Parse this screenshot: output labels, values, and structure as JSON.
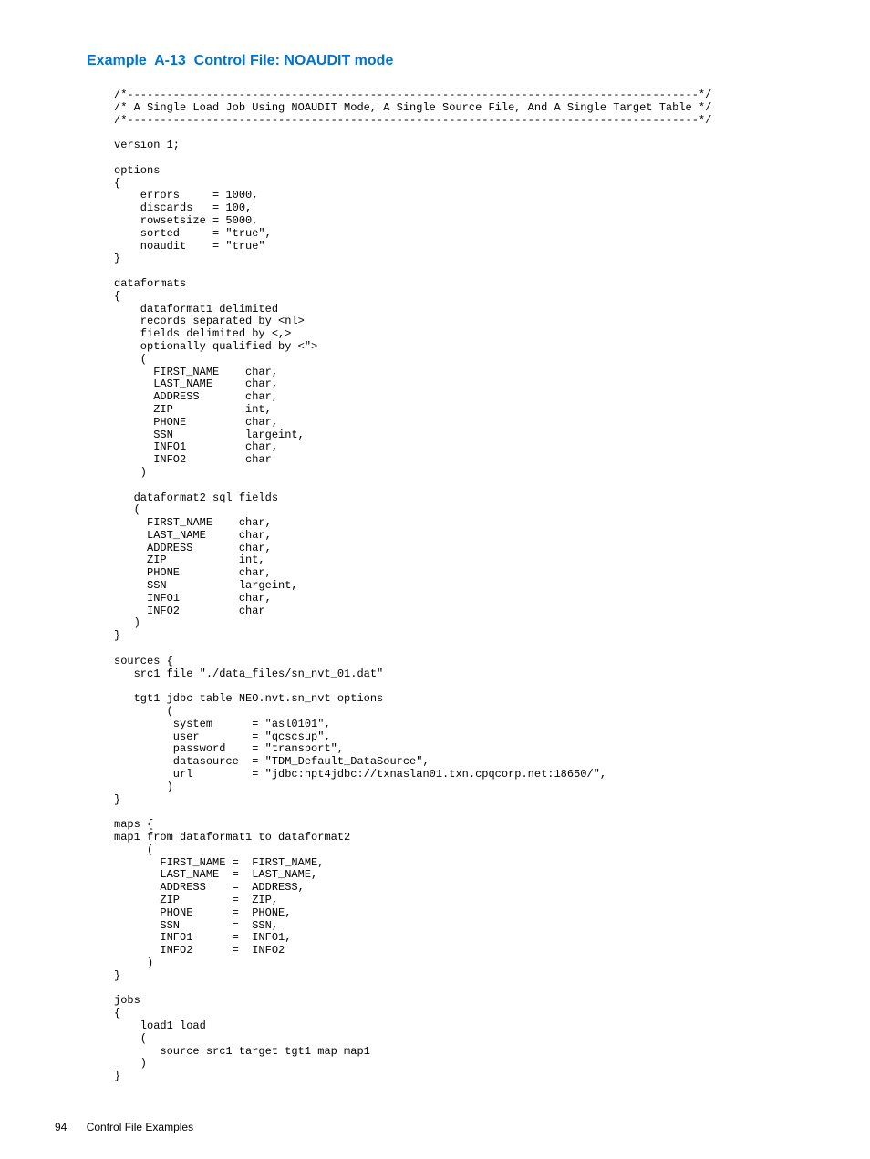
{
  "title": "Example  A-13  Control File: NOAUDIT mode",
  "code": "/*---------------------------------------------------------------------------------------*/\n/* A Single Load Job Using NOAUDIT Mode, A Single Source File, And A Single Target Table */\n/*---------------------------------------------------------------------------------------*/\n\nversion 1;\n\noptions\n{\n    errors     = 1000,\n    discards   = 100,\n    rowsetsize = 5000,\n    sorted     = \"true\",\n    noaudit    = \"true\"\n}\n\ndataformats\n{\n    dataformat1 delimited\n    records separated by <nl>\n    fields delimited by <,>\n    optionally qualified by <\">\n    (\n      FIRST_NAME    char,\n      LAST_NAME     char,\n      ADDRESS       char,\n      ZIP           int,\n      PHONE         char,\n      SSN           largeint,\n      INFO1         char,\n      INFO2         char\n    )\n\n   dataformat2 sql fields\n   (\n     FIRST_NAME    char,\n     LAST_NAME     char,\n     ADDRESS       char,\n     ZIP           int,\n     PHONE         char,\n     SSN           largeint,\n     INFO1         char,\n     INFO2         char\n   )\n}\n\nsources {\n   src1 file \"./data_files/sn_nvt_01.dat\"\n\n   tgt1 jdbc table NEO.nvt.sn_nvt options\n        (\n         system      = \"asl0101\",\n         user        = \"qcscsup\",\n         password    = \"transport\",\n         datasource  = \"TDM_Default_DataSource\",\n         url         = \"jdbc:hpt4jdbc://txnaslan01.txn.cpqcorp.net:18650/\",\n        )\n}\n\nmaps {\nmap1 from dataformat1 to dataformat2\n     (\n       FIRST_NAME =  FIRST_NAME,\n       LAST_NAME  =  LAST_NAME,\n       ADDRESS    =  ADDRESS,\n       ZIP        =  ZIP,\n       PHONE      =  PHONE,\n       SSN        =  SSN,\n       INFO1      =  INFO1,\n       INFO2      =  INFO2\n     )\n}\n\njobs\n{\n    load1 load\n    (\n       source src1 target tgt1 map map1\n    )\n}",
  "footer": {
    "page": "94",
    "section": "Control File Examples"
  }
}
